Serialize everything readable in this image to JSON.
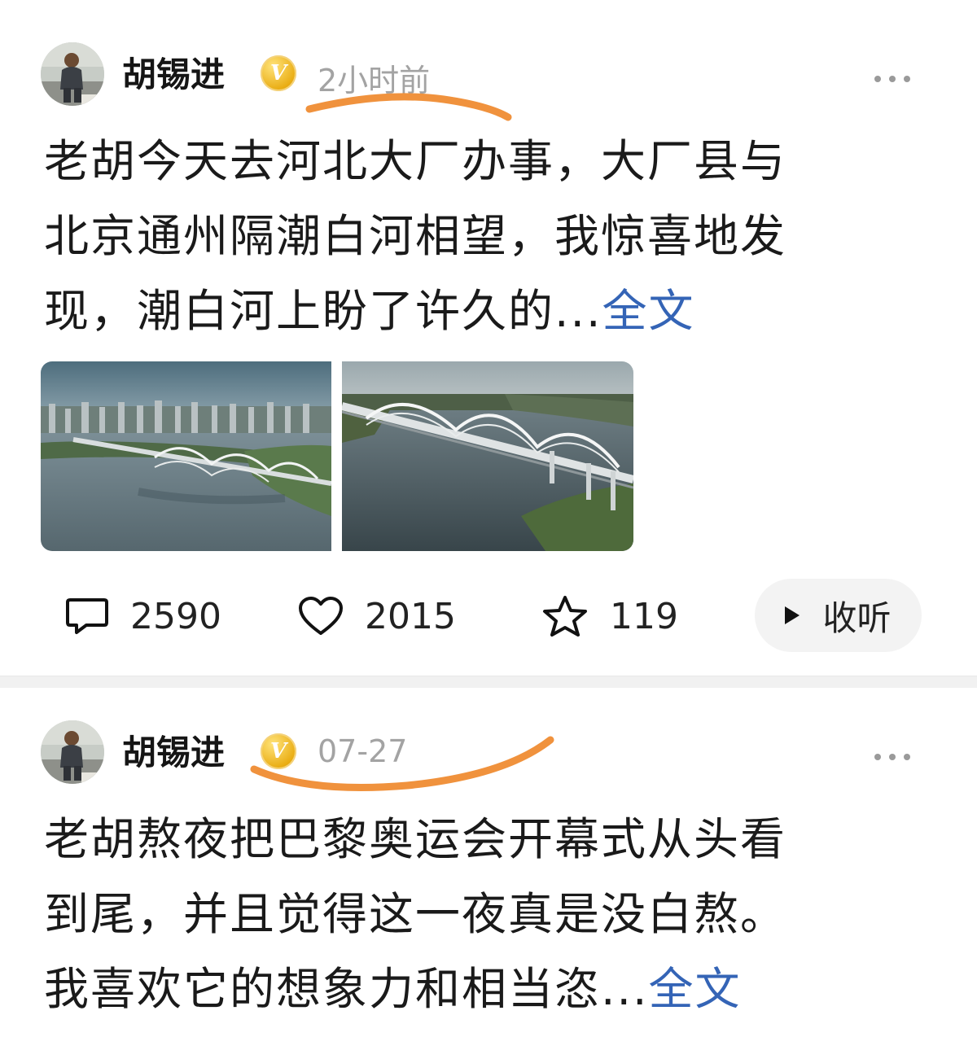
{
  "posts": [
    {
      "author": "胡锡进",
      "verified_badge": "V",
      "time": "2小时前",
      "content_lines": [
        "老胡今天去河北大厂办事，大厂县与",
        "北京通州隔潮白河相望，我惊喜地发",
        "现，潮白河上盼了许久的..."
      ],
      "full_text_link": "全文",
      "images": [
        "bridge-aerial-city-photo",
        "bridge-aerial-river-photo"
      ],
      "actions": {
        "comments": "2590",
        "likes": "2015",
        "favorites": "119",
        "listen": "收听"
      },
      "highlight_color": "#f0923d"
    },
    {
      "author": "胡锡进",
      "verified_badge": "V",
      "time": "07-27",
      "content_lines": [
        "老胡熬夜把巴黎奥运会开幕式从头看",
        "到尾，并且觉得这一夜真是没白熬。",
        "我喜欢它的想象力和相当恣..."
      ],
      "full_text_link": "全文",
      "highlight_color": "#f0923d"
    }
  ],
  "colors": {
    "link": "#3464b6",
    "timestamp": "#a3a3a3",
    "highlight": "#f0923d",
    "badge": "#e9ac12"
  },
  "icons": {
    "more": "more-dots-icon",
    "comment": "comment-bubble-icon",
    "like": "heart-icon",
    "favorite": "star-icon",
    "play": "play-icon"
  }
}
